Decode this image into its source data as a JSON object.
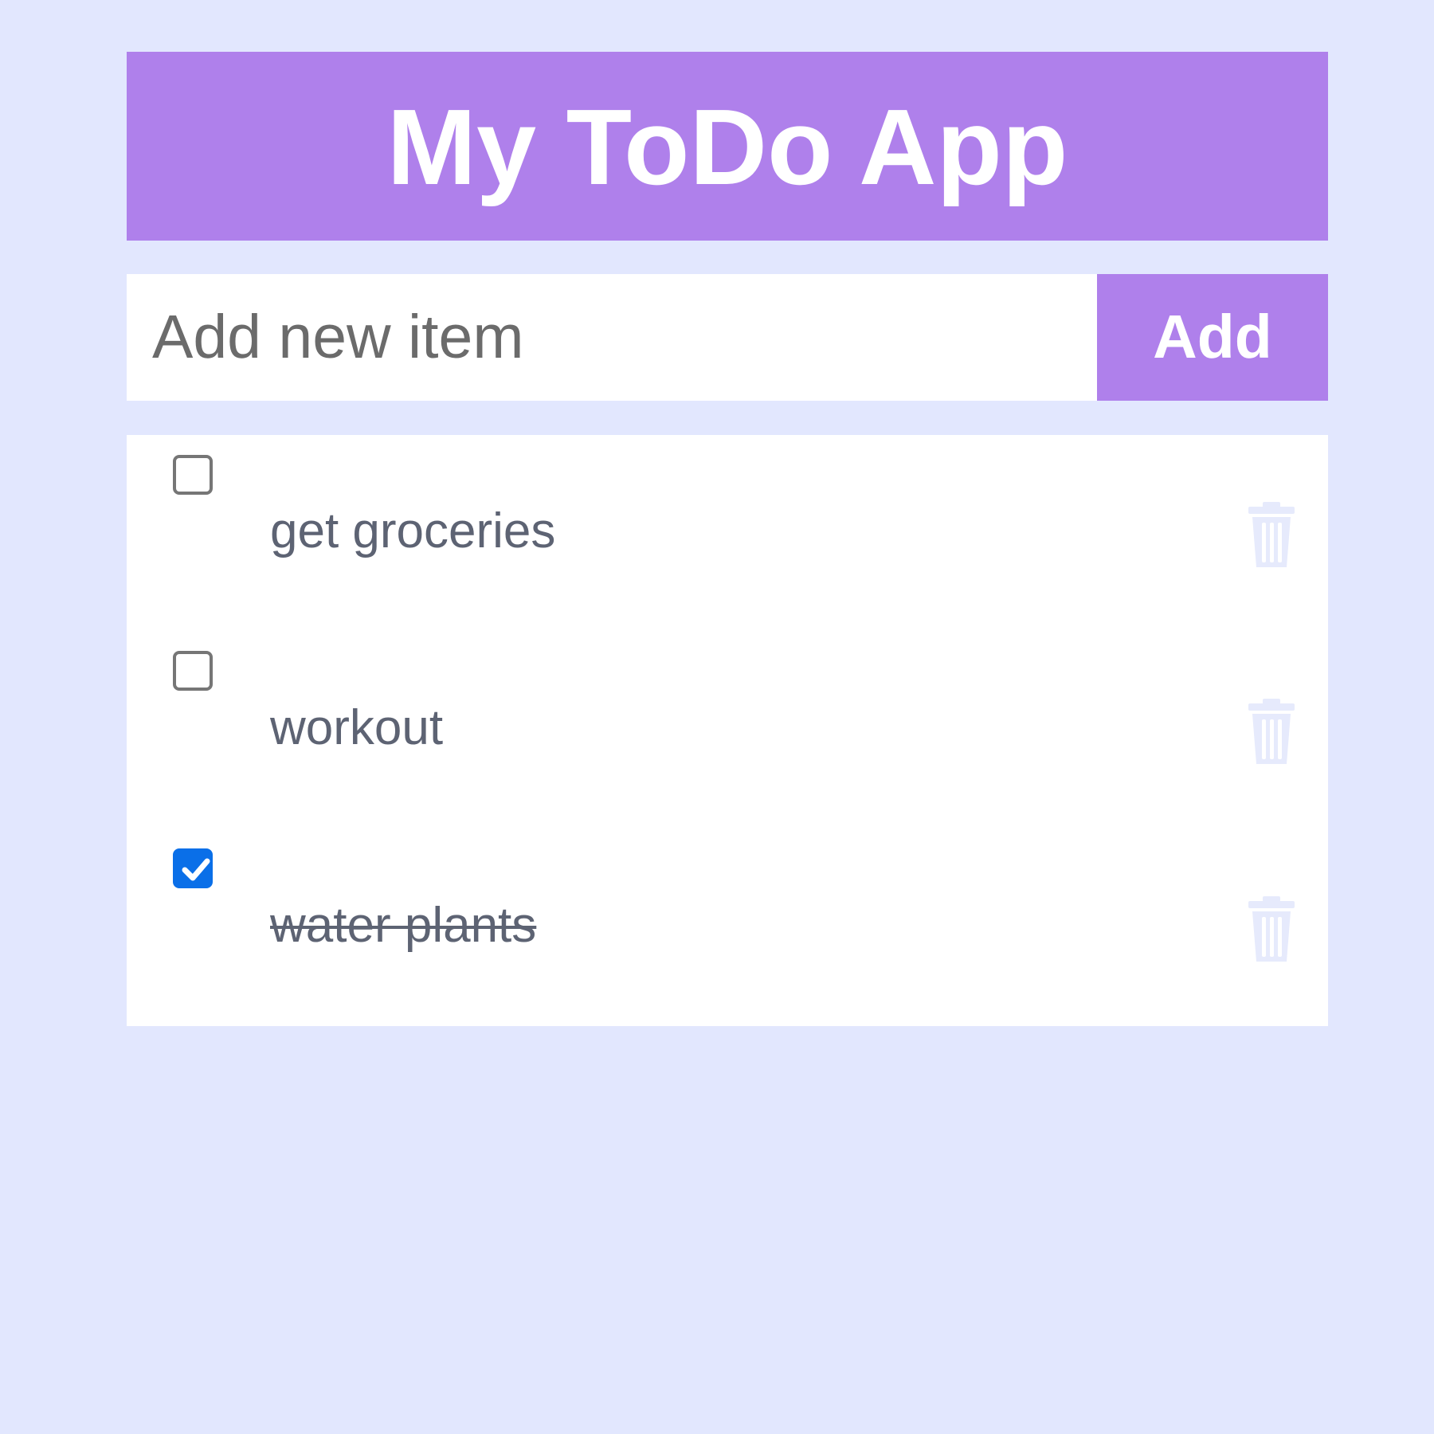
{
  "header": {
    "title": "My ToDo App"
  },
  "add_form": {
    "placeholder": "Add new item",
    "value": "",
    "button_label": "Add"
  },
  "todos": [
    {
      "text": "get groceries",
      "done": false
    },
    {
      "text": "workout",
      "done": false
    },
    {
      "text": "water plants",
      "done": true
    }
  ],
  "colors": {
    "background": "#e2e7fe",
    "accent": "#af80eb",
    "checkbox_checked": "#0a6fe8",
    "trash_icon": "#e6eafc"
  },
  "icons": {
    "delete": "trash-icon",
    "checked": "checkmark-icon"
  }
}
